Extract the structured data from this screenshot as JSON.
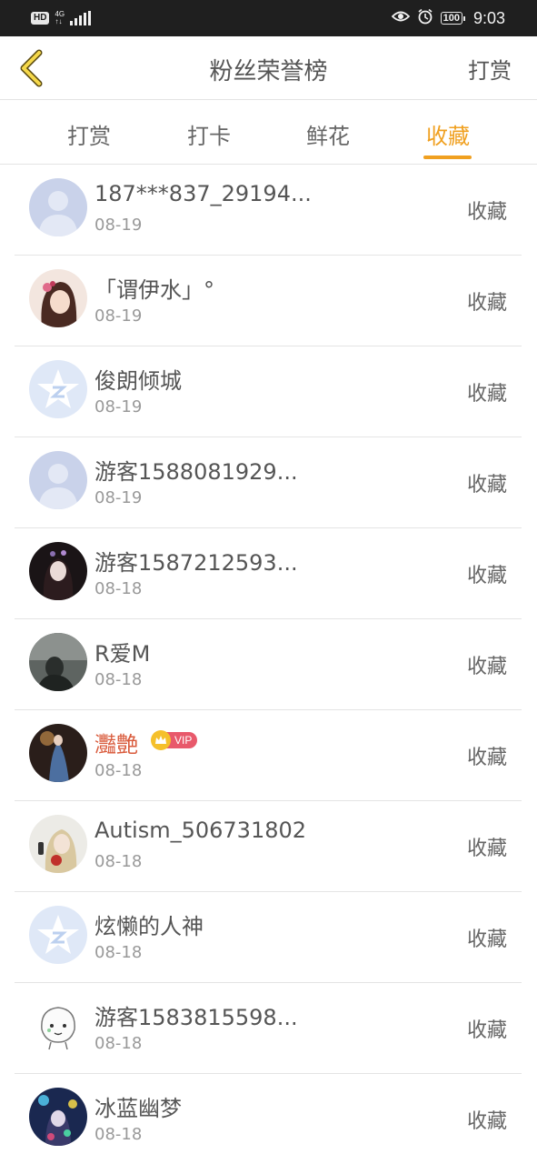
{
  "status_bar": {
    "hd": "HD",
    "network": "4G",
    "battery": "100",
    "time": "9:03"
  },
  "header": {
    "title": "粉丝荣誉榜",
    "action": "打赏"
  },
  "tabs": [
    {
      "label": "打赏",
      "active": false
    },
    {
      "label": "打卡",
      "active": false
    },
    {
      "label": "鲜花",
      "active": false
    },
    {
      "label": "收藏",
      "active": true
    }
  ],
  "colors": {
    "accent": "#f0a020",
    "vip_name": "#d95a3b",
    "vip_badge": "#e8596b",
    "crown": "#f5c02b"
  },
  "fans": [
    {
      "name": "187***837_29194...",
      "date": "08-19",
      "action": "收藏",
      "avatar": "default-person-avatar"
    },
    {
      "name": "「谓伊水」°",
      "date": "08-19",
      "action": "收藏",
      "avatar": "photo-avatar-pink"
    },
    {
      "name": "俊朗倾城",
      "date": "08-19",
      "action": "收藏",
      "avatar": "star-logo-avatar"
    },
    {
      "name": "游客1588081929...",
      "date": "08-19",
      "action": "收藏",
      "avatar": "default-person-avatar"
    },
    {
      "name": "游客1587212593...",
      "date": "08-18",
      "action": "收藏",
      "avatar": "photo-avatar-dark"
    },
    {
      "name": "R爱M",
      "date": "08-18",
      "action": "收藏",
      "avatar": "photo-avatar-gray"
    },
    {
      "name": "灩艶",
      "date": "08-18",
      "action": "收藏",
      "avatar": "photo-avatar-blue",
      "vip": true,
      "vip_label": "VIP"
    },
    {
      "name": "Autism_506731802",
      "date": "08-18",
      "action": "收藏",
      "avatar": "photo-avatar-light"
    },
    {
      "name": "炫懒的人神",
      "date": "08-18",
      "action": "收藏",
      "avatar": "star-logo-avatar"
    },
    {
      "name": "游客1583815598...",
      "date": "08-18",
      "action": "收藏",
      "avatar": "cartoon-avatar"
    },
    {
      "name": "冰蓝幽梦",
      "date": "08-18",
      "action": "收藏",
      "avatar": "photo-avatar-colorful"
    }
  ]
}
